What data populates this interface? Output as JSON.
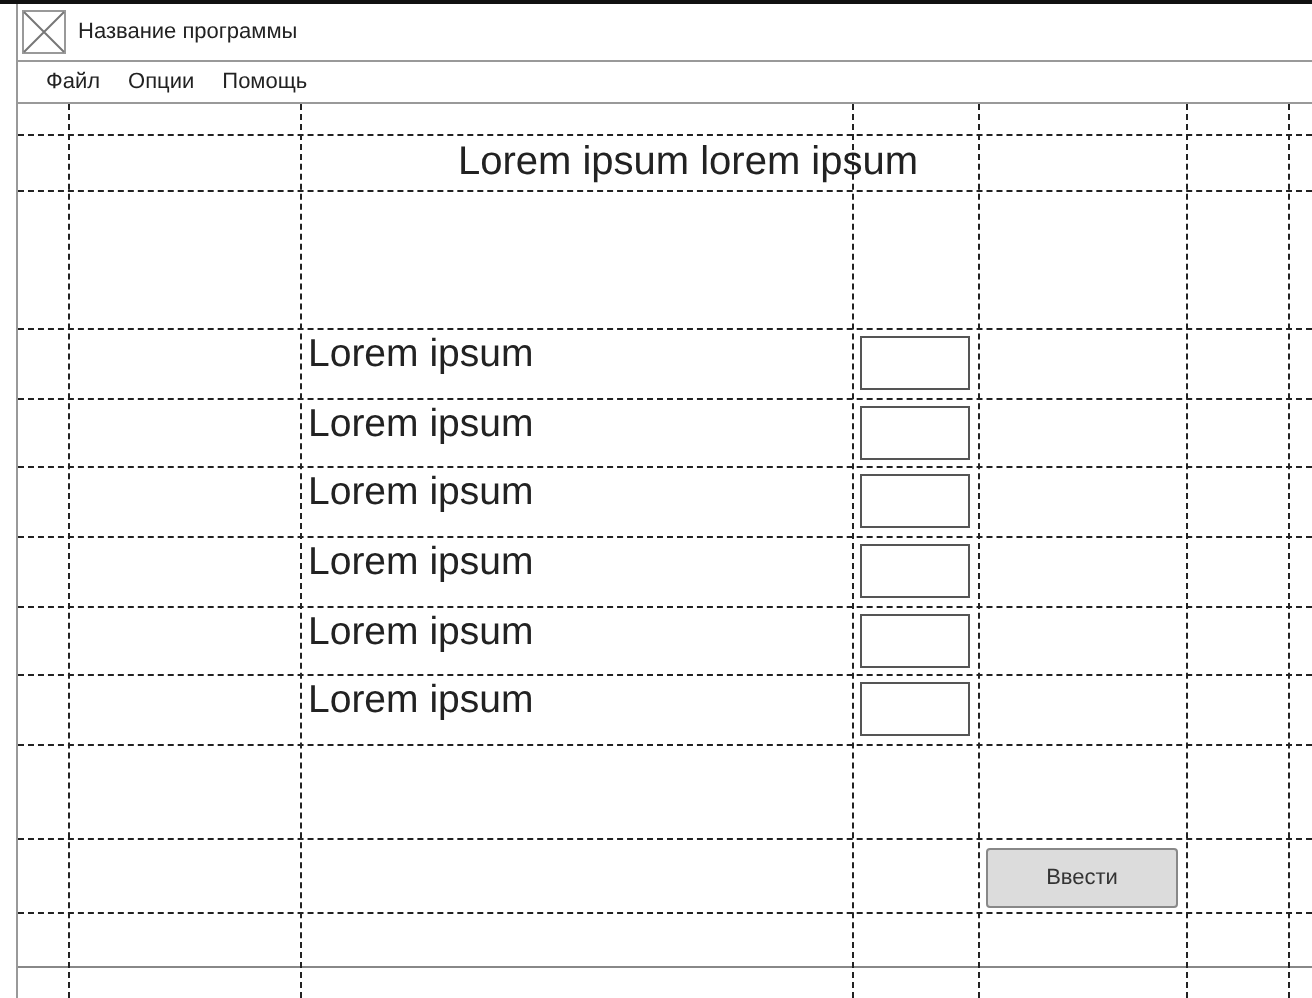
{
  "window": {
    "title": "Название программы"
  },
  "menu": [
    "Файл",
    "Опции",
    "Помощь"
  ],
  "heading": "Lorem ipsum lorem ipsum",
  "rows": [
    {
      "label": "Lorem ipsum"
    },
    {
      "label": "Lorem ipsum"
    },
    {
      "label": "Lorem ipsum"
    },
    {
      "label": "Lorem ipsum"
    },
    {
      "label": "Lorem ipsum"
    },
    {
      "label": "Lorem ipsum"
    }
  ],
  "submit_button": "Ввести"
}
